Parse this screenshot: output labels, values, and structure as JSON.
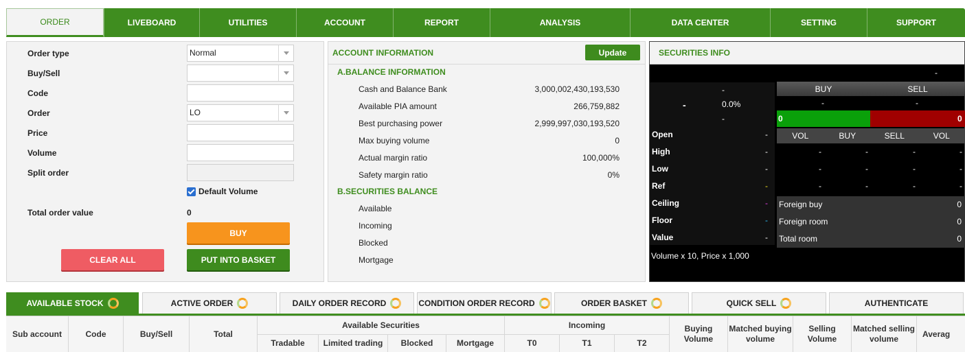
{
  "nav": {
    "tabs": [
      "ORDER",
      "LIVEBOARD",
      "UTILITIES",
      "ACCOUNT",
      "REPORT",
      "ANALYSIS",
      "DATA CENTER",
      "SETTING",
      "SUPPORT"
    ],
    "active": "ORDER"
  },
  "order_form": {
    "labels": {
      "order_type": "Order type",
      "buy_sell": "Buy/Sell",
      "code": "Code",
      "order": "Order",
      "price": "Price",
      "volume": "Volume",
      "split_order": "Split order",
      "total_order_value": "Total order value"
    },
    "values": {
      "order_type": "Normal",
      "buy_sell": "",
      "code": "",
      "order": "LO",
      "price": "",
      "volume": "",
      "split_order": "",
      "total_order_value": "0"
    },
    "default_volume_label": "Default Volume",
    "default_volume_checked": true,
    "buttons": {
      "buy": "BUY",
      "clear_all": "CLEAR ALL",
      "put_into_basket": "PUT INTO BASKET"
    }
  },
  "account_info": {
    "title": "ACCOUNT INFORMATION",
    "update_label": "Update",
    "balance_title": "A.BALANCE INFORMATION",
    "balance_rows": [
      {
        "label": "Cash and Balance Bank",
        "value": "3,000,002,430,193,530"
      },
      {
        "label": "Available PIA amount",
        "value": "266,759,882"
      },
      {
        "label": "Best purchasing power",
        "value": "2,999,997,030,193,520"
      },
      {
        "label": "Max buying volume",
        "value": "0"
      },
      {
        "label": "Actual margin ratio",
        "value": "100,000%"
      },
      {
        "label": "Safety margin ratio",
        "value": "0%"
      }
    ],
    "securities_title": "B.SECURITIES BALANCE",
    "securities_rows": [
      "Available",
      "Incoming",
      "Blocked",
      "Mortgage"
    ]
  },
  "securities_info": {
    "title": "SECURITIES INFO",
    "top_dash": "-",
    "price_change": "-",
    "price": "-",
    "percent": "0.0%",
    "volume": "-",
    "buy_label": "BUY",
    "sell_label": "SELL",
    "buy_value": "-",
    "sell_value": "-",
    "buy_total": "0",
    "sell_total": "0",
    "depth_headers": [
      "VOL",
      "BUY",
      "SELL",
      "VOL"
    ],
    "depth_rows": [
      [
        "-",
        "-",
        "-",
        "-"
      ],
      [
        "-",
        "-",
        "-",
        "-"
      ],
      [
        "-",
        "-",
        "-",
        "-"
      ]
    ],
    "stats": [
      {
        "label": "Open",
        "value": "-"
      },
      {
        "label": "High",
        "value": "-"
      },
      {
        "label": "Low",
        "value": "-"
      },
      {
        "label": "Ref",
        "value": "-"
      },
      {
        "label": "Ceiling",
        "value": "-"
      },
      {
        "label": "Floor",
        "value": "-"
      },
      {
        "label": "Value",
        "value": "-"
      }
    ],
    "foreign": [
      {
        "label": "Foreign buy",
        "value": "0"
      },
      {
        "label": "Foreign room",
        "value": "0"
      },
      {
        "label": "Total room",
        "value": "0"
      }
    ],
    "note": "Volume x 10, Price x 1,000",
    "colors": {
      "buy_bar": "#0aa00a",
      "sell_bar": "#a00000",
      "ref": "#f0e020",
      "ceiling": "#e040e0",
      "floor": "#30b8f0"
    }
  },
  "bottom_tabs": [
    "AVAILABLE STOCK",
    "ACTIVE ORDER",
    "DAILY ORDER RECORD",
    "CONDITION ORDER RECORD",
    "ORDER BASKET",
    "QUICK SELL",
    "AUTHENTICATE"
  ],
  "table": {
    "headers": {
      "sub_account": "Sub account",
      "code": "Code",
      "buy_sell": "Buy/Sell",
      "total": "Total",
      "available_securities": "Available Securities",
      "tradable": "Tradable",
      "limited_trading": "Limited trading",
      "blocked": "Blocked",
      "mortgage": "Mortgage",
      "incoming": "Incoming",
      "t0": "T0",
      "t1": "T1",
      "t2": "T2",
      "buying_volume": "Buying Volume",
      "matched_buying_volume": "Matched buying volume",
      "selling_volume": "Selling Volume",
      "matched_selling_volume": "Matched selling volume",
      "average": "Averag"
    }
  }
}
